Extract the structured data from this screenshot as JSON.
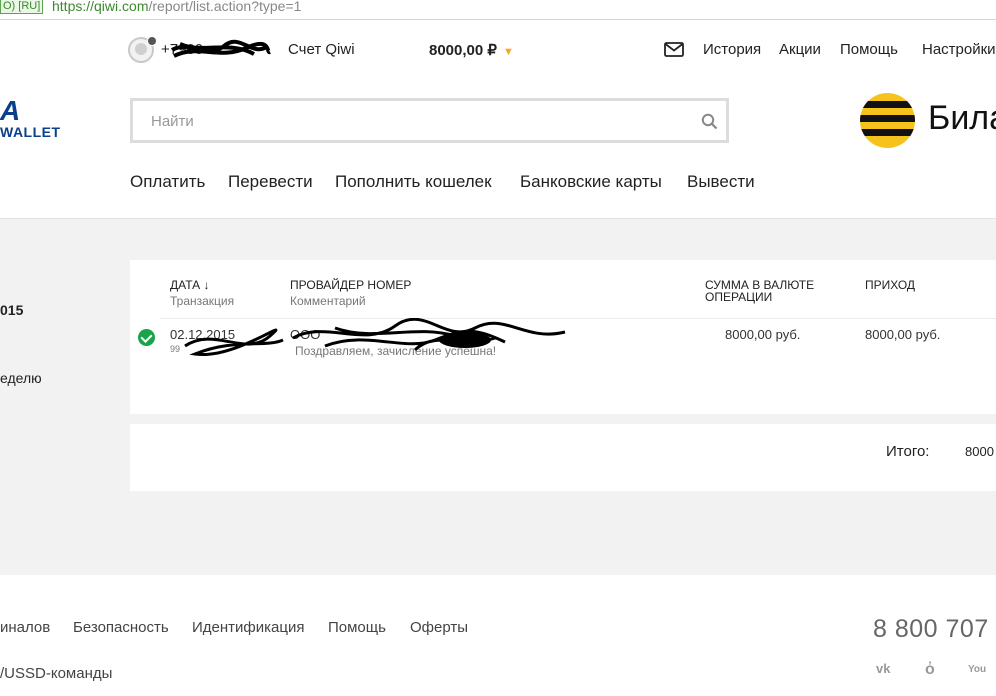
{
  "browser": {
    "security_badge": "O) [RU]",
    "url_host": "https://qiwi.com",
    "url_path": "/report/list.action?type=1"
  },
  "header": {
    "phone": "+7900",
    "account_label": "Счет Qiwi",
    "balance": "8000,00 ₽",
    "links": [
      "История",
      "Акции",
      "Помощь",
      "Настройки"
    ]
  },
  "logo": {
    "line1": "A",
    "line2": "WALLET"
  },
  "search": {
    "placeholder": "Найти",
    "value": ""
  },
  "ad": {
    "brand_text": "Била"
  },
  "nav": [
    "Оплатить",
    "Перевести",
    "Пополнить кошелек",
    "Банковские карты",
    "Вывести"
  ],
  "sidebar": {
    "item1": "015",
    "item2": "еделю"
  },
  "table": {
    "headers": {
      "date": "ДАТА ↓",
      "date_sub": "Транзакция",
      "provider": "ПРОВАЙДЕР НОМЕР",
      "provider_sub": "Комментарий",
      "amount": "СУММА В ВАЛЮТЕ ОПЕРАЦИИ",
      "income": "ПРИХОД"
    },
    "rows": [
      {
        "date": "02.12.2015",
        "txn": "99",
        "provider": "ООО",
        "comment": "Поздравляем, зачисление успешна!",
        "amount": "8000,00 руб.",
        "income": "8000,00 руб."
      }
    ]
  },
  "totals": {
    "label": "Итого:",
    "value": "8000"
  },
  "footer": {
    "links": [
      "иналов",
      "Безопасность",
      "Идентификация",
      "Помощь",
      "Оферты"
    ],
    "hotline": "8 800 707",
    "ussd": "/USSD-команды",
    "social": [
      "vk-icon",
      "odnoklassniki-icon",
      "youtube-icon"
    ]
  },
  "colors": {
    "brand_blue": "#0c3f8a",
    "accent_orange": "#f5a623",
    "success_green": "#1aa34a",
    "beeline_yellow": "#f7c21b"
  }
}
